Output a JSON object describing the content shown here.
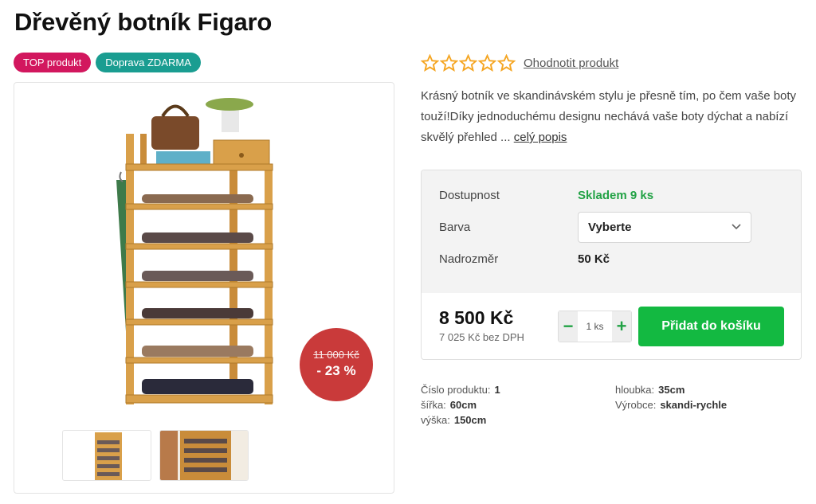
{
  "product": {
    "title": "Dřevěný botník Figaro",
    "badges": [
      "TOP produkt",
      "Doprava ZDARMA"
    ],
    "rating_link": "Ohodnotit produkt",
    "stars": 0,
    "description": "Krásný botník ve skandinávském stylu je přesně tím, po čem vaše boty touží!Díky jednoduchému designu nechává vaše boty dýchat a nabízí skvělý přehled ...",
    "description_more": "celý popis"
  },
  "discount": {
    "old_price": "11 000 Kč",
    "percent": "- 23 %"
  },
  "purchase": {
    "availability_label": "Dostupnost",
    "availability_value": "Skladem 9 ks",
    "color_label": "Barva",
    "color_value": "Vyberte",
    "oversize_label": "Nadrozměr",
    "oversize_value": "50 Kč",
    "price": "8 500 Kč",
    "price_novat": "7 025 Kč bez DPH",
    "qty_minus": "−",
    "qty_value": "1 ks",
    "qty_plus": "+",
    "add_to_cart": "Přidat do košíku"
  },
  "specs": {
    "col1": [
      {
        "label": "Číslo produktu:",
        "value": "1"
      },
      {
        "label": "šířka:",
        "value": "60cm"
      },
      {
        "label": "výška:",
        "value": "150cm"
      }
    ],
    "col2": [
      {
        "label": "hloubka:",
        "value": "35cm"
      },
      {
        "label": "Výrobce:",
        "value": "skandi-rychle"
      }
    ]
  },
  "colors": {
    "badge_top": "#d2175e",
    "badge_shipping": "#1a9d91",
    "star": "#f5a623",
    "stock": "#22a245",
    "cart_button": "#13b941",
    "discount": "#c93a3a"
  }
}
